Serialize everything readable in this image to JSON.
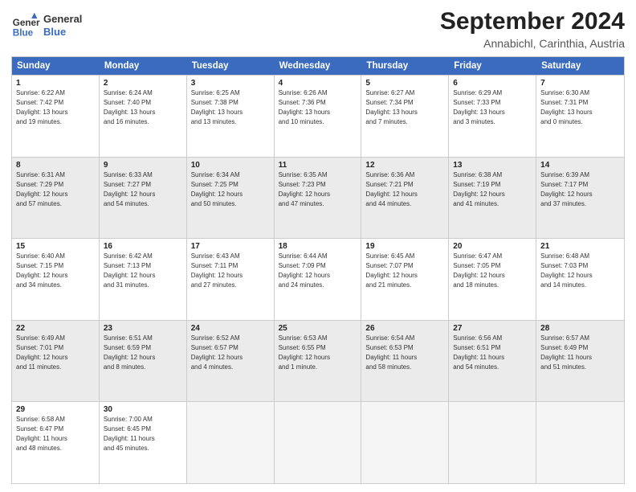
{
  "header": {
    "logo_line1": "General",
    "logo_line2": "Blue",
    "main_title": "September 2024",
    "subtitle": "Annabichl, Carinthia, Austria"
  },
  "calendar": {
    "days_of_week": [
      "Sunday",
      "Monday",
      "Tuesday",
      "Wednesday",
      "Thursday",
      "Friday",
      "Saturday"
    ],
    "rows": [
      {
        "shaded": false,
        "cells": [
          {
            "day": "1",
            "lines": [
              "Sunrise: 6:22 AM",
              "Sunset: 7:42 PM",
              "Daylight: 13 hours",
              "and 19 minutes."
            ]
          },
          {
            "day": "2",
            "lines": [
              "Sunrise: 6:24 AM",
              "Sunset: 7:40 PM",
              "Daylight: 13 hours",
              "and 16 minutes."
            ]
          },
          {
            "day": "3",
            "lines": [
              "Sunrise: 6:25 AM",
              "Sunset: 7:38 PM",
              "Daylight: 13 hours",
              "and 13 minutes."
            ]
          },
          {
            "day": "4",
            "lines": [
              "Sunrise: 6:26 AM",
              "Sunset: 7:36 PM",
              "Daylight: 13 hours",
              "and 10 minutes."
            ]
          },
          {
            "day": "5",
            "lines": [
              "Sunrise: 6:27 AM",
              "Sunset: 7:34 PM",
              "Daylight: 13 hours",
              "and 7 minutes."
            ]
          },
          {
            "day": "6",
            "lines": [
              "Sunrise: 6:29 AM",
              "Sunset: 7:33 PM",
              "Daylight: 13 hours",
              "and 3 minutes."
            ]
          },
          {
            "day": "7",
            "lines": [
              "Sunrise: 6:30 AM",
              "Sunset: 7:31 PM",
              "Daylight: 13 hours",
              "and 0 minutes."
            ]
          }
        ]
      },
      {
        "shaded": true,
        "cells": [
          {
            "day": "8",
            "lines": [
              "Sunrise: 6:31 AM",
              "Sunset: 7:29 PM",
              "Daylight: 12 hours",
              "and 57 minutes."
            ]
          },
          {
            "day": "9",
            "lines": [
              "Sunrise: 6:33 AM",
              "Sunset: 7:27 PM",
              "Daylight: 12 hours",
              "and 54 minutes."
            ]
          },
          {
            "day": "10",
            "lines": [
              "Sunrise: 6:34 AM",
              "Sunset: 7:25 PM",
              "Daylight: 12 hours",
              "and 50 minutes."
            ]
          },
          {
            "day": "11",
            "lines": [
              "Sunrise: 6:35 AM",
              "Sunset: 7:23 PM",
              "Daylight: 12 hours",
              "and 47 minutes."
            ]
          },
          {
            "day": "12",
            "lines": [
              "Sunrise: 6:36 AM",
              "Sunset: 7:21 PM",
              "Daylight: 12 hours",
              "and 44 minutes."
            ]
          },
          {
            "day": "13",
            "lines": [
              "Sunrise: 6:38 AM",
              "Sunset: 7:19 PM",
              "Daylight: 12 hours",
              "and 41 minutes."
            ]
          },
          {
            "day": "14",
            "lines": [
              "Sunrise: 6:39 AM",
              "Sunset: 7:17 PM",
              "Daylight: 12 hours",
              "and 37 minutes."
            ]
          }
        ]
      },
      {
        "shaded": false,
        "cells": [
          {
            "day": "15",
            "lines": [
              "Sunrise: 6:40 AM",
              "Sunset: 7:15 PM",
              "Daylight: 12 hours",
              "and 34 minutes."
            ]
          },
          {
            "day": "16",
            "lines": [
              "Sunrise: 6:42 AM",
              "Sunset: 7:13 PM",
              "Daylight: 12 hours",
              "and 31 minutes."
            ]
          },
          {
            "day": "17",
            "lines": [
              "Sunrise: 6:43 AM",
              "Sunset: 7:11 PM",
              "Daylight: 12 hours",
              "and 27 minutes."
            ]
          },
          {
            "day": "18",
            "lines": [
              "Sunrise: 6:44 AM",
              "Sunset: 7:09 PM",
              "Daylight: 12 hours",
              "and 24 minutes."
            ]
          },
          {
            "day": "19",
            "lines": [
              "Sunrise: 6:45 AM",
              "Sunset: 7:07 PM",
              "Daylight: 12 hours",
              "and 21 minutes."
            ]
          },
          {
            "day": "20",
            "lines": [
              "Sunrise: 6:47 AM",
              "Sunset: 7:05 PM",
              "Daylight: 12 hours",
              "and 18 minutes."
            ]
          },
          {
            "day": "21",
            "lines": [
              "Sunrise: 6:48 AM",
              "Sunset: 7:03 PM",
              "Daylight: 12 hours",
              "and 14 minutes."
            ]
          }
        ]
      },
      {
        "shaded": true,
        "cells": [
          {
            "day": "22",
            "lines": [
              "Sunrise: 6:49 AM",
              "Sunset: 7:01 PM",
              "Daylight: 12 hours",
              "and 11 minutes."
            ]
          },
          {
            "day": "23",
            "lines": [
              "Sunrise: 6:51 AM",
              "Sunset: 6:59 PM",
              "Daylight: 12 hours",
              "and 8 minutes."
            ]
          },
          {
            "day": "24",
            "lines": [
              "Sunrise: 6:52 AM",
              "Sunset: 6:57 PM",
              "Daylight: 12 hours",
              "and 4 minutes."
            ]
          },
          {
            "day": "25",
            "lines": [
              "Sunrise: 6:53 AM",
              "Sunset: 6:55 PM",
              "Daylight: 12 hours",
              "and 1 minute."
            ]
          },
          {
            "day": "26",
            "lines": [
              "Sunrise: 6:54 AM",
              "Sunset: 6:53 PM",
              "Daylight: 11 hours",
              "and 58 minutes."
            ]
          },
          {
            "day": "27",
            "lines": [
              "Sunrise: 6:56 AM",
              "Sunset: 6:51 PM",
              "Daylight: 11 hours",
              "and 54 minutes."
            ]
          },
          {
            "day": "28",
            "lines": [
              "Sunrise: 6:57 AM",
              "Sunset: 6:49 PM",
              "Daylight: 11 hours",
              "and 51 minutes."
            ]
          }
        ]
      },
      {
        "shaded": false,
        "cells": [
          {
            "day": "29",
            "lines": [
              "Sunrise: 6:58 AM",
              "Sunset: 6:47 PM",
              "Daylight: 11 hours",
              "and 48 minutes."
            ]
          },
          {
            "day": "30",
            "lines": [
              "Sunrise: 7:00 AM",
              "Sunset: 6:45 PM",
              "Daylight: 11 hours",
              "and 45 minutes."
            ]
          },
          {
            "day": "",
            "lines": []
          },
          {
            "day": "",
            "lines": []
          },
          {
            "day": "",
            "lines": []
          },
          {
            "day": "",
            "lines": []
          },
          {
            "day": "",
            "lines": []
          }
        ]
      }
    ]
  }
}
